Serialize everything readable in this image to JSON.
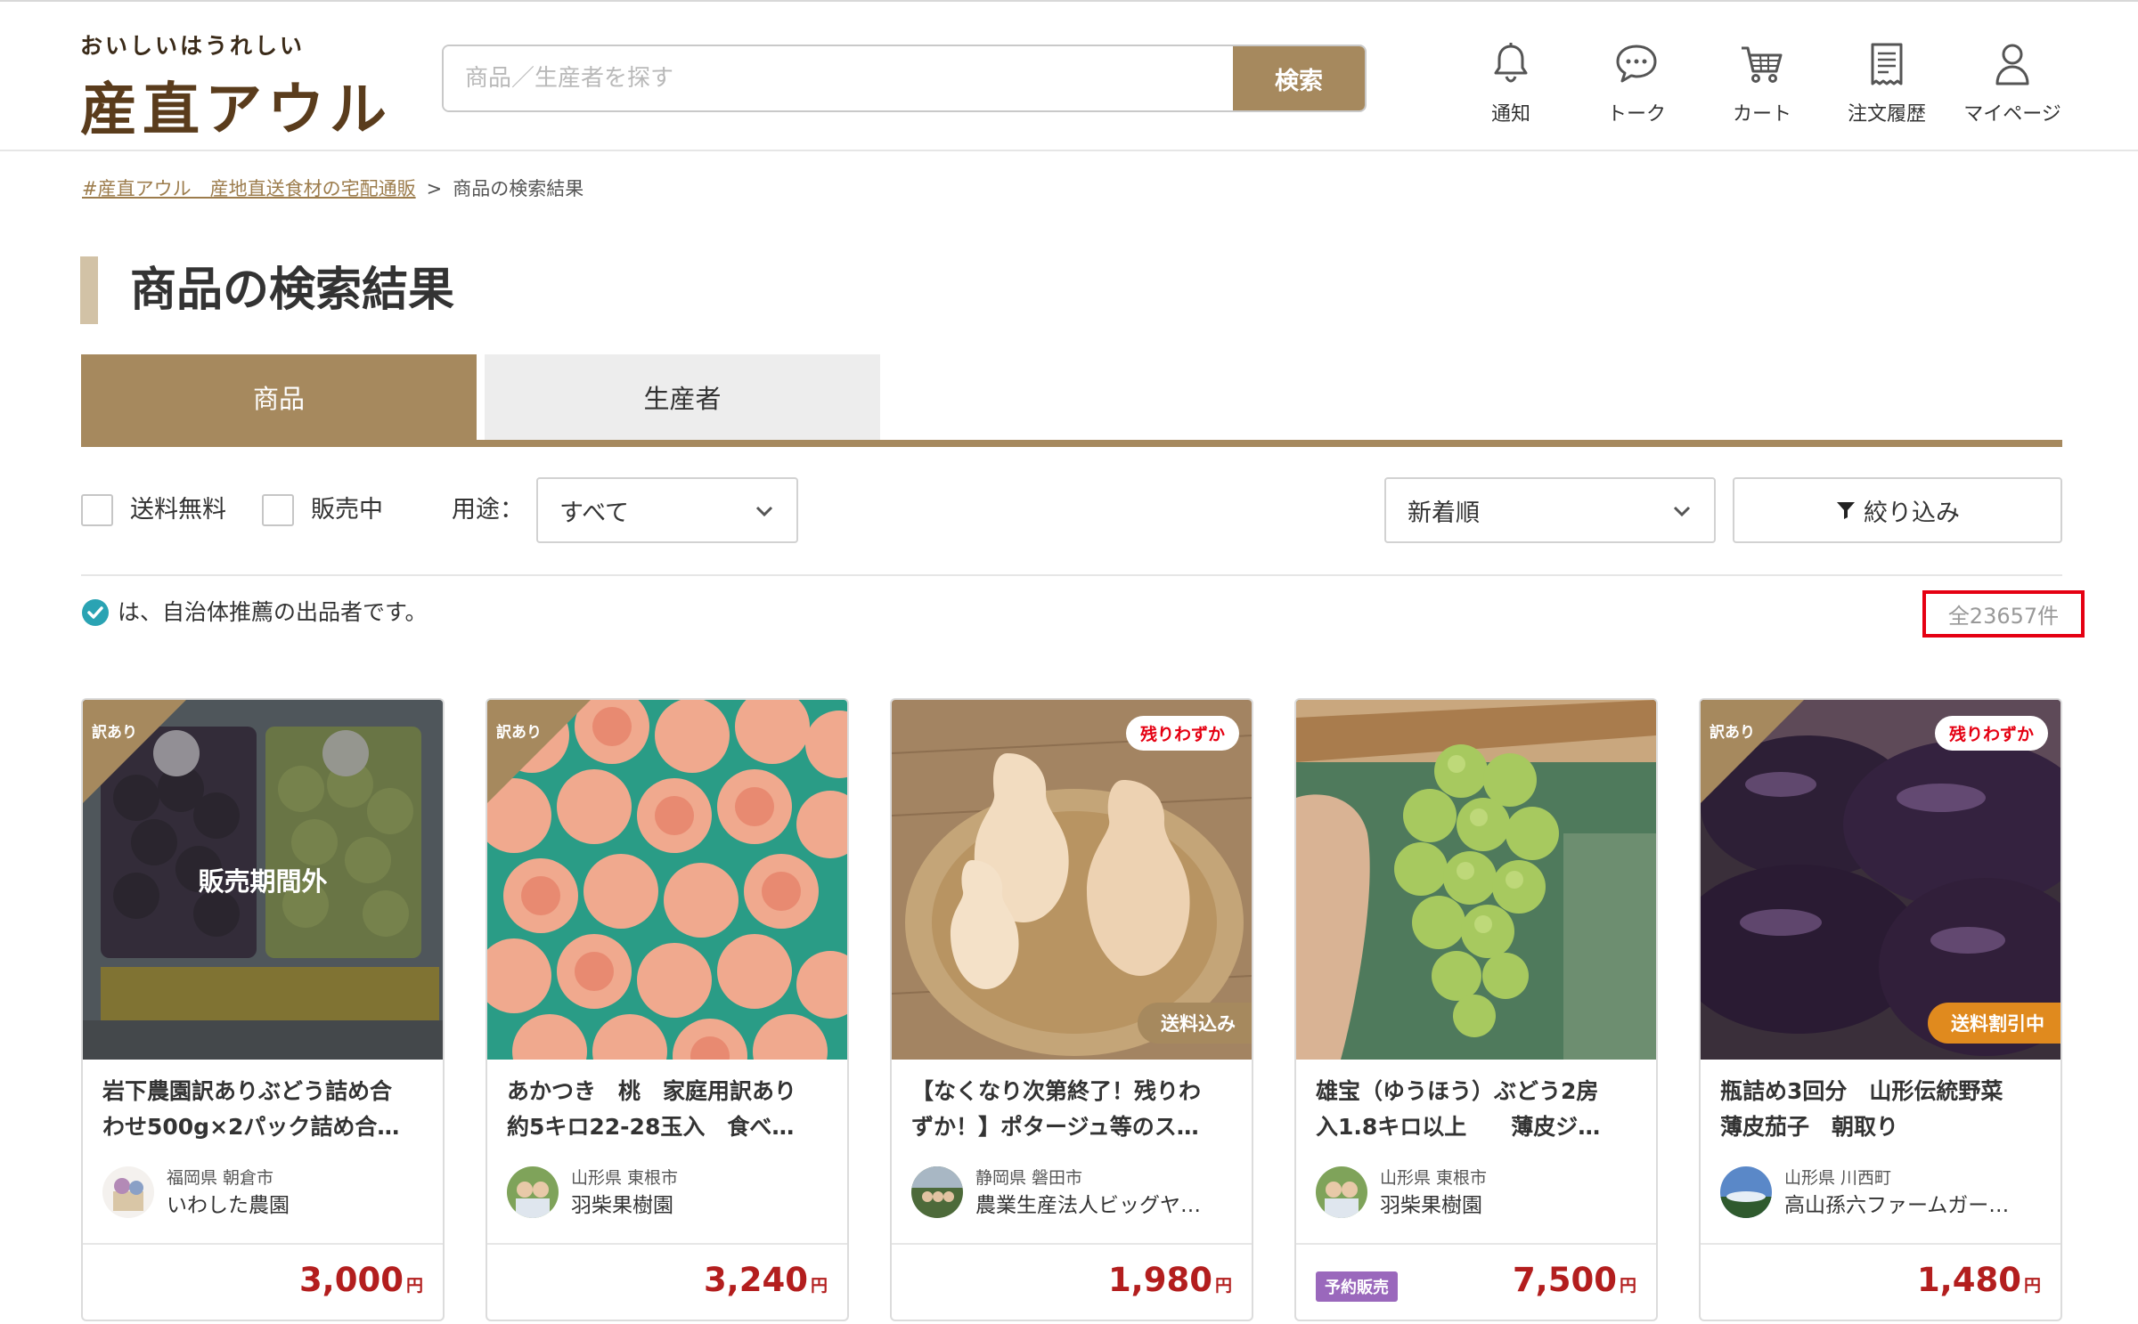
{
  "header": {
    "logo_sub": "おいしいはうれしい",
    "logo_main": "産直アウル",
    "search_placeholder": "商品／生産者を探す",
    "search_button": "検索",
    "nav": [
      {
        "label": "通知",
        "icon": "bell-icon"
      },
      {
        "label": "トーク",
        "icon": "chat-icon"
      },
      {
        "label": "カート",
        "icon": "cart-icon"
      },
      {
        "label": "注文履歴",
        "icon": "receipt-icon"
      },
      {
        "label": "マイページ",
        "icon": "user-icon"
      }
    ]
  },
  "breadcrumb": {
    "home": "#産直アウル　産地直送食材の宅配通販",
    "separator": ">",
    "current": "商品の検索結果"
  },
  "page_title": "商品の検索結果",
  "tabs": [
    {
      "label": "商品",
      "active": true
    },
    {
      "label": "生産者",
      "active": false
    }
  ],
  "filters": {
    "free_shipping": "送料無料",
    "on_sale": "販売中",
    "usage_label": "用途：",
    "usage_value": "すべて",
    "sort_value": "新着順",
    "narrow_button": "絞り込み"
  },
  "recommend_note": "は、自治体推薦の出品者です。",
  "total_count": "全23657件",
  "colors": {
    "brand": "#a6895e",
    "price": "#b31e1e",
    "badge_red": "#e50012",
    "reserve": "#9a68bc",
    "discount": "#e08a1e"
  },
  "products": [
    {
      "title_line1": "岩下農園訳ありぶどう詰め合",
      "title_line2": "わせ500g×2パック詰め合…",
      "tag": "訳あり",
      "overlay": "販売期間外",
      "prefecture": "福岡県 朝倉市",
      "producer": "いわした農園",
      "price": "3,000",
      "yen": "円"
    },
    {
      "title_line1": "あかつき　桃　家庭用訳あり",
      "title_line2": "約5キロ22-28玉入　食べ…",
      "tag": "訳あり",
      "prefecture": "山形県 東根市",
      "producer": "羽柴果樹園",
      "price": "3,240",
      "yen": "円"
    },
    {
      "title_line1": "【なくなり次第終了！残りわ",
      "title_line2": "ずか！】ポタージュ等のス…",
      "badge_top": "残りわずか",
      "badge_bottom": "送料込み",
      "prefecture": "静岡県 磐田市",
      "producer": "農業生産法人ビッグヤ…",
      "price": "1,980",
      "yen": "円"
    },
    {
      "title_line1": "雄宝（ゆうほう）ぶどう2房",
      "title_line2": "入1.8キロ以上　　薄皮ジ…",
      "prefecture": "山形県 東根市",
      "producer": "羽柴果樹園",
      "reserve": "予約販売",
      "price": "7,500",
      "yen": "円"
    },
    {
      "title_line1": "瓶詰め3回分　山形伝統野菜",
      "title_line2": "薄皮茄子　朝取り",
      "tag": "訳あり",
      "badge_top": "残りわずか",
      "badge_bottom": "送料割引中",
      "prefecture": "山形県 川西町",
      "producer": "高山孫六ファームガー…",
      "price": "1,480",
      "yen": "円"
    }
  ]
}
